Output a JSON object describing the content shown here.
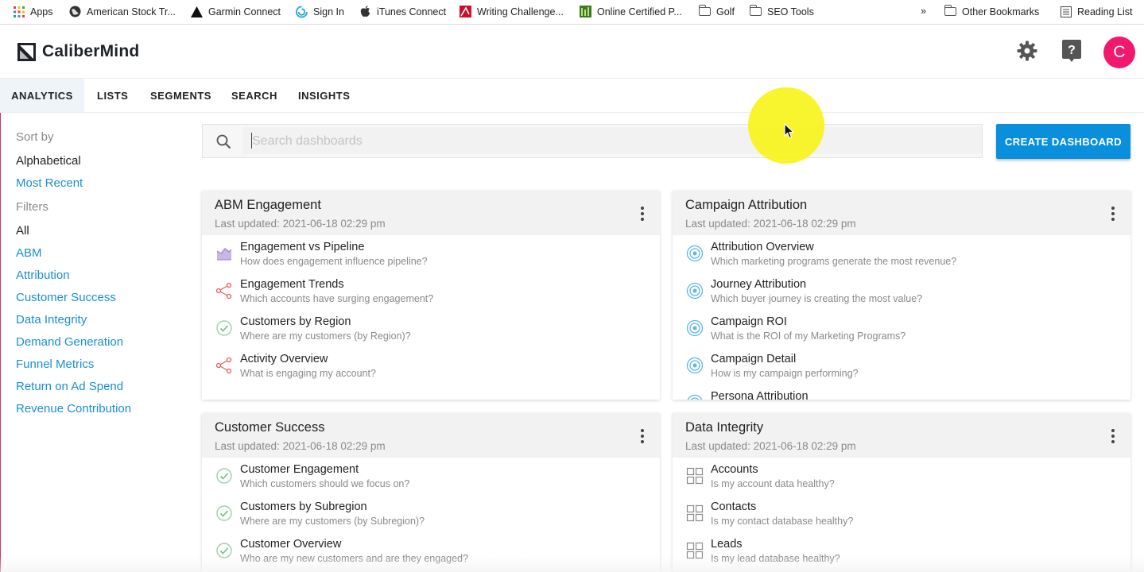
{
  "bookmarks": {
    "items": [
      {
        "label": "Apps",
        "icon": "apps-grid-icon"
      },
      {
        "label": "American Stock Tr...",
        "icon": "globe-icon"
      },
      {
        "label": "Garmin Connect",
        "icon": "garmin-triangle-icon"
      },
      {
        "label": "Sign In",
        "icon": "swirl-icon"
      },
      {
        "label": "iTunes Connect",
        "icon": "apple-icon"
      },
      {
        "label": "Writing Challenge...",
        "icon": "writing-red-icon"
      },
      {
        "label": "Online Certified P...",
        "icon": "green-bars-icon"
      },
      {
        "label": "Golf",
        "icon": "folder-icon"
      },
      {
        "label": "SEO Tools",
        "icon": "folder-icon"
      }
    ],
    "overflow": "»",
    "other": "Other Bookmarks",
    "reading_list": "Reading List"
  },
  "header": {
    "brand": "CaliberMind",
    "avatar_initial": "C",
    "avatar_color": "#f0196e"
  },
  "nav": {
    "tabs": [
      "ANALYTICS",
      "LISTS",
      "SEGMENTS",
      "SEARCH",
      "INSIGHTS"
    ],
    "active": "ANALYTICS"
  },
  "sidebar": {
    "sort_heading": "Sort by",
    "sort_options": [
      "Alphabetical",
      "Most Recent"
    ],
    "filters_heading": "Filters",
    "filters": [
      "All",
      "ABM",
      "Attribution",
      "Customer Success",
      "Data Integrity",
      "Demand Generation",
      "Funnel Metrics",
      "Return on Ad Spend",
      "Revenue Contribution"
    ]
  },
  "search": {
    "placeholder": "Search dashboards",
    "value": ""
  },
  "create_button": "CREATE DASHBOARD",
  "accent_color": "#0a8fdc",
  "cards": [
    {
      "title": "ABM Engagement",
      "updated": "Last updated: 2021-06-18 02:29 pm",
      "rows": [
        {
          "title": "Engagement vs Pipeline",
          "subtitle": "How does engagement influence pipeline?",
          "icon": "area-chart-icon"
        },
        {
          "title": "Engagement Trends",
          "subtitle": "Which accounts have surging engagement?",
          "icon": "share-nodes-icon"
        },
        {
          "title": "Customers by Region",
          "subtitle": "Where are my customers (by Region)?",
          "icon": "check-circle-icon"
        },
        {
          "title": "Activity Overview",
          "subtitle": "What is engaging my account?",
          "icon": "share-nodes-icon"
        }
      ]
    },
    {
      "title": "Campaign Attribution",
      "updated": "Last updated: 2021-06-18 02:29 pm",
      "rows": [
        {
          "title": "Attribution Overview",
          "subtitle": "Which marketing programs generate the most revenue?",
          "icon": "target-icon"
        },
        {
          "title": "Journey Attribution",
          "subtitle": "Which buyer journey is creating the most value?",
          "icon": "target-icon"
        },
        {
          "title": "Campaign ROI",
          "subtitle": "What is the ROI of my Marketing Programs?",
          "icon": "target-icon"
        },
        {
          "title": "Campaign Detail",
          "subtitle": "How is my campaign performing?",
          "icon": "target-icon"
        },
        {
          "title": "Persona Attribution",
          "subtitle": "",
          "icon": "target-icon"
        }
      ]
    },
    {
      "title": "Customer Success",
      "updated": "Last updated: 2021-06-18 02:29 pm",
      "rows": [
        {
          "title": "Customer Engagement",
          "subtitle": "Which customers should we focus on?",
          "icon": "check-circle-icon"
        },
        {
          "title": "Customers by Subregion",
          "subtitle": "Where are my customers (by Subregion)?",
          "icon": "check-circle-icon"
        },
        {
          "title": "Customer Overview",
          "subtitle": "Who are my new customers and are they engaged?",
          "icon": "check-circle-icon"
        }
      ]
    },
    {
      "title": "Data Integrity",
      "updated": "Last updated: 2021-06-18 02:29 pm",
      "rows": [
        {
          "title": "Accounts",
          "subtitle": "Is my account data healthy?",
          "icon": "grid-icon"
        },
        {
          "title": "Contacts",
          "subtitle": "Is my contact database healthy?",
          "icon": "grid-icon"
        },
        {
          "title": "Leads",
          "subtitle": "Is my lead database healthy?",
          "icon": "grid-icon"
        }
      ]
    }
  ]
}
